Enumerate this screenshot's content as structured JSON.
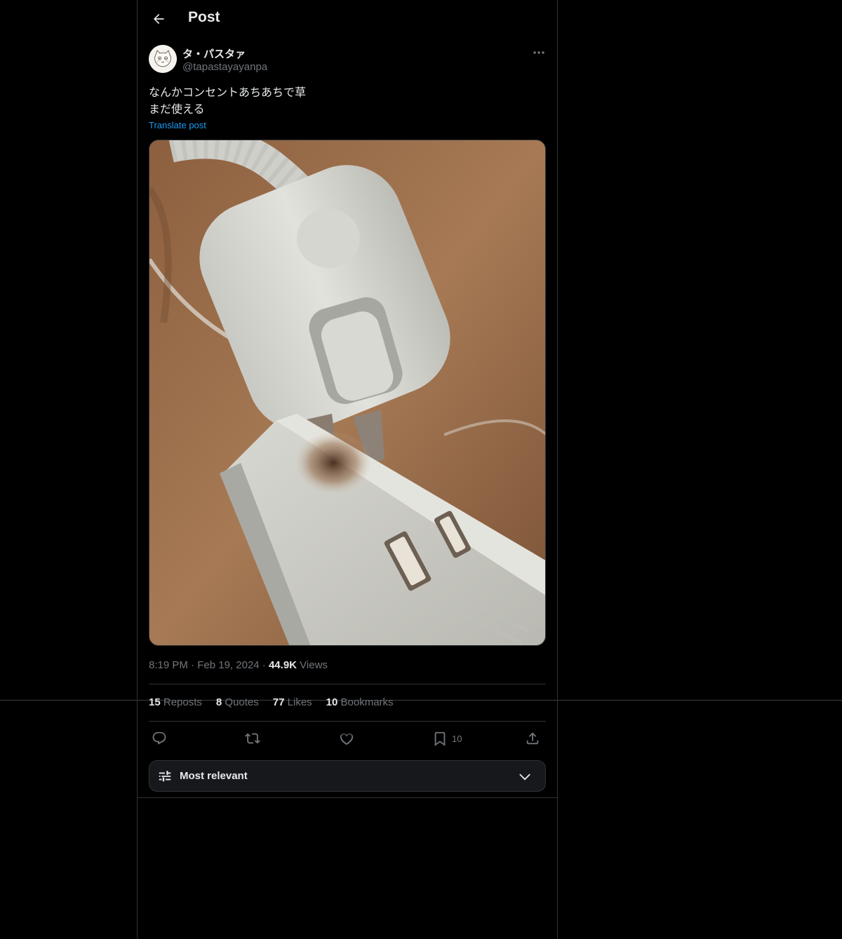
{
  "header": {
    "title": "Post",
    "back_icon": "arrow-left-icon"
  },
  "author": {
    "name": "タ・パスタァ",
    "handle": "@tapastayayanpa"
  },
  "post": {
    "lines": [
      "なんかコンセントあちあちで草",
      "まだ使える"
    ],
    "translate_label": "Translate post"
  },
  "meta": {
    "time": "8:19 PM",
    "sep1": "·",
    "date": "Feb 19, 2024",
    "sep2": "·",
    "views_count": "44.9K",
    "views_label": "Views"
  },
  "stats": {
    "reposts": {
      "num": "15",
      "label": "Reposts"
    },
    "quotes": {
      "num": "8",
      "label": "Quotes"
    },
    "likes": {
      "num": "77",
      "label": "Likes"
    },
    "bookmarks": {
      "num": "10",
      "label": "Bookmarks"
    }
  },
  "actions": {
    "reply_icon": "reply-icon",
    "repost_icon": "repost-icon",
    "like_icon": "heart-icon",
    "bookmark_icon": "bookmark-icon",
    "bookmark_count": "10",
    "share_icon": "share-icon"
  },
  "sort": {
    "label": "Most relevant",
    "icon": "sliders-icon",
    "chevron": "chevron-down-icon"
  },
  "colors": {
    "accent": "#1d9bf0",
    "muted": "#71767b",
    "text": "#e7e9ea",
    "border": "#2f3336"
  }
}
